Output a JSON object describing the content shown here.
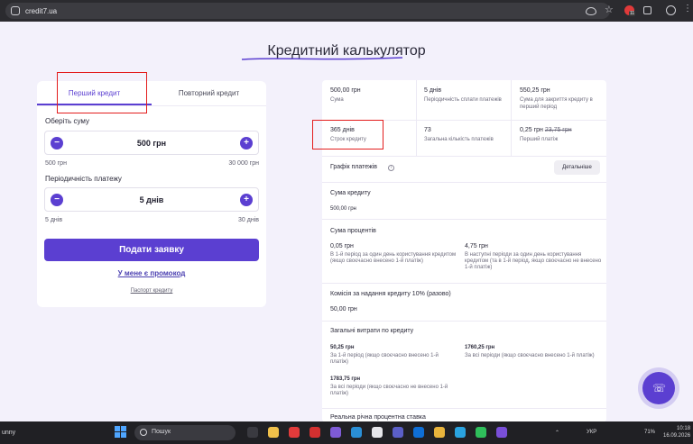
{
  "browser": {
    "url": "credit7.ua",
    "extension_badge": "11"
  },
  "page": {
    "title": "Кредитний калькулятор"
  },
  "left_panel": {
    "tabs": [
      {
        "label": "Перший кредит",
        "active": true
      },
      {
        "label": "Повторний кредит",
        "active": false
      }
    ],
    "amount_label": "Оберіть суму",
    "amount_value": "500 грн",
    "amount_min": "500 грн",
    "amount_max": "30 000 грн",
    "period_label": "Періодичність платежу",
    "period_value": "5 днів",
    "period_min": "5 днів",
    "period_max": "30 днів",
    "submit_label": "Подати заявку",
    "promo_label": "У мене є промокод",
    "passport_label": "Паспорт кредиту"
  },
  "summary": {
    "cells": [
      {
        "value": "500,00 грн",
        "label": "Сума"
      },
      {
        "value": "5 днів",
        "label": "Періодичність сплати платежів"
      },
      {
        "value": "550,25 грн",
        "label": "Сума для закриття кредиту в перший період"
      },
      {
        "value": "365 днів",
        "label": "Строк кредиту"
      },
      {
        "value": "73",
        "label": "Загальна кількість платежів"
      },
      {
        "value": "0,25 грн",
        "value_old": "23,75 грн",
        "label": "Перший платіж"
      }
    ]
  },
  "schedule": {
    "title": "Графік платежів",
    "details_button": "Детальніше",
    "sections": {
      "credit_amount": {
        "title": "Сума кредиту",
        "value": "500,00 грн"
      },
      "interest": {
        "title": "Сума процентів",
        "first_value": "0,05 грн",
        "first_note": "В 1-й період за один день користування кредитом (якщо своєчасно внесено 1-й платіж)",
        "second_value": "4,75 грн",
        "second_note": "В наступні періоди за один день користування кредитом (та в 1-й період, якщо своєчасно не внесено 1-й платіж)"
      },
      "commission": {
        "title": "Комісія за надання кредиту 10% (разово)",
        "value": "50,00 грн"
      },
      "total": {
        "title": "Загальні витрати по кредиту",
        "v1": "50,25 грн",
        "n1": "За 1-й період (якщо своєчасно внесено 1-й платіж)",
        "v2": "1760,25 грн",
        "n2": "За всі періоди (якщо своєчасно внесено 1-й платіж)",
        "v3": "1783,75 грн",
        "n3": "За всі періоди (якщо своєчасно не внесено 1-й платіж)"
      },
      "apr": {
        "title": "Реальна річна процентна ставка"
      }
    }
  },
  "taskbar": {
    "left_text": "unny",
    "search_placeholder": "Пошук",
    "lang": "УКР",
    "battery": "71%",
    "time": "10:18",
    "date": "16.09.2026"
  }
}
